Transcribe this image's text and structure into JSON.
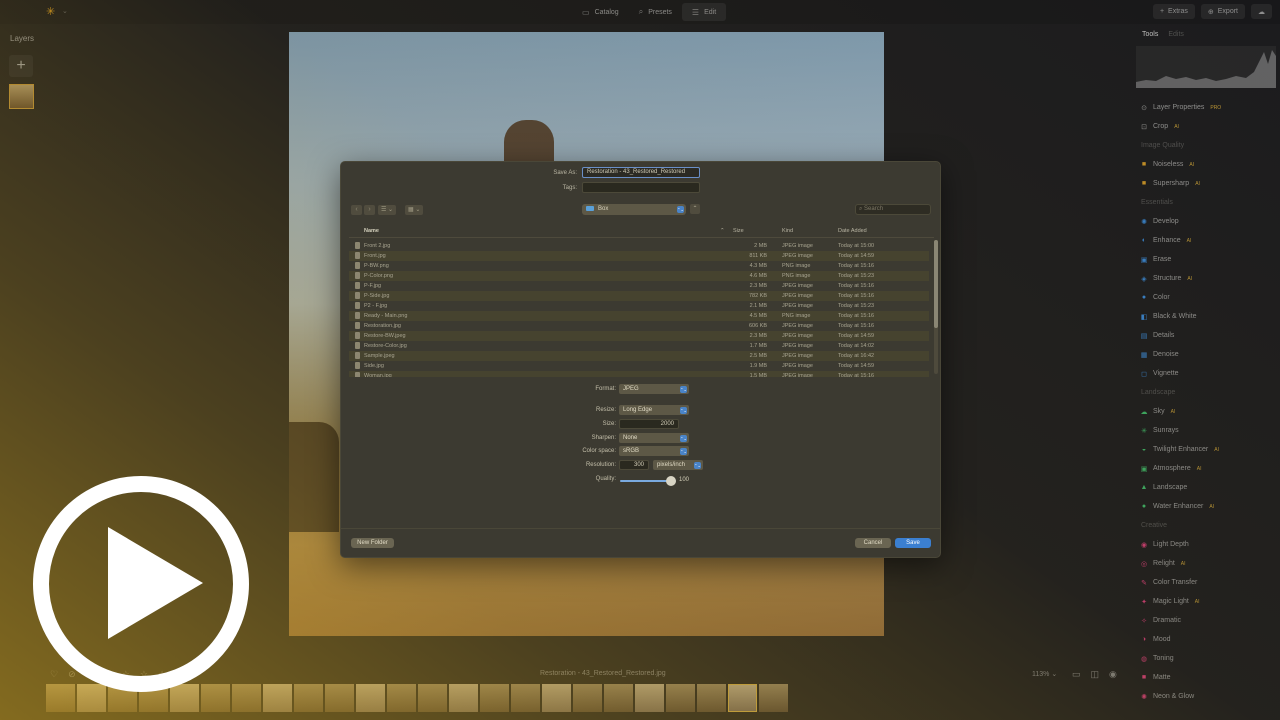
{
  "topbar": {
    "logo_icon": "✳",
    "modes": [
      {
        "icon": "▭",
        "label": "Catalog"
      },
      {
        "icon": "⌕",
        "label": "Presets"
      },
      {
        "icon": "☰",
        "label": "Edit"
      }
    ],
    "extras_label": "Extras",
    "export_label": "Export"
  },
  "layers": {
    "title": "Layers",
    "add_icon": "+"
  },
  "right_panel": {
    "tabs": [
      "Tools",
      "Edits"
    ],
    "items": [
      {
        "type": "item",
        "icon": "⊙",
        "color": "#9a9a9a",
        "label": "Layer Properties",
        "tag": "PRO"
      },
      {
        "type": "item",
        "icon": "⊡",
        "color": "#9a9a9a",
        "label": "Crop",
        "tag": "AI"
      },
      {
        "type": "section",
        "label": "Image Quality"
      },
      {
        "type": "item",
        "icon": "■",
        "color": "#d19a2a",
        "label": "Noiseless",
        "tag": "AI"
      },
      {
        "type": "item",
        "icon": "■",
        "color": "#d19a2a",
        "label": "Supersharp",
        "tag": "AI"
      },
      {
        "type": "section",
        "label": "Essentials"
      },
      {
        "type": "item",
        "icon": "✺",
        "color": "#3b8ad8",
        "label": "Develop",
        "tag": ""
      },
      {
        "type": "item",
        "icon": "◐",
        "color": "#3b8ad8",
        "label": "Enhance",
        "tag": "AI"
      },
      {
        "type": "item",
        "icon": "▣",
        "color": "#3b8ad8",
        "label": "Erase",
        "tag": ""
      },
      {
        "type": "item",
        "icon": "◈",
        "color": "#3b8ad8",
        "label": "Structure",
        "tag": "AI"
      },
      {
        "type": "item",
        "icon": "●",
        "color": "#3b8ad8",
        "label": "Color",
        "tag": ""
      },
      {
        "type": "item",
        "icon": "◧",
        "color": "#3b8ad8",
        "label": "Black & White",
        "tag": ""
      },
      {
        "type": "item",
        "icon": "▤",
        "color": "#3b8ad8",
        "label": "Details",
        "tag": ""
      },
      {
        "type": "item",
        "icon": "▦",
        "color": "#3b8ad8",
        "label": "Denoise",
        "tag": ""
      },
      {
        "type": "item",
        "icon": "◻",
        "color": "#3b8ad8",
        "label": "Vignette",
        "tag": ""
      },
      {
        "type": "section",
        "label": "Landscape"
      },
      {
        "type": "item",
        "icon": "☁",
        "color": "#3fb86a",
        "label": "Sky",
        "tag": "AI"
      },
      {
        "type": "item",
        "icon": "✳",
        "color": "#3fb86a",
        "label": "Sunrays",
        "tag": ""
      },
      {
        "type": "item",
        "icon": "◒",
        "color": "#3fb86a",
        "label": "Twilight Enhancer",
        "tag": "AI"
      },
      {
        "type": "item",
        "icon": "▣",
        "color": "#3fb86a",
        "label": "Atmosphere",
        "tag": "AI"
      },
      {
        "type": "item",
        "icon": "▲",
        "color": "#3fb86a",
        "label": "Landscape",
        "tag": ""
      },
      {
        "type": "item",
        "icon": "●",
        "color": "#3fb86a",
        "label": "Water Enhancer",
        "tag": "AI"
      },
      {
        "type": "section",
        "label": "Creative"
      },
      {
        "type": "item",
        "icon": "◉",
        "color": "#d8407a",
        "label": "Light Depth",
        "tag": ""
      },
      {
        "type": "item",
        "icon": "◎",
        "color": "#d8407a",
        "label": "Relight",
        "tag": "AI"
      },
      {
        "type": "item",
        "icon": "✎",
        "color": "#d8407a",
        "label": "Color Transfer",
        "tag": ""
      },
      {
        "type": "item",
        "icon": "✦",
        "color": "#d8407a",
        "label": "Magic Light",
        "tag": "AI"
      },
      {
        "type": "item",
        "icon": "✧",
        "color": "#d8407a",
        "label": "Dramatic",
        "tag": ""
      },
      {
        "type": "item",
        "icon": "◑",
        "color": "#d8407a",
        "label": "Mood",
        "tag": ""
      },
      {
        "type": "item",
        "icon": "◍",
        "color": "#d8407a",
        "label": "Toning",
        "tag": ""
      },
      {
        "type": "item",
        "icon": "■",
        "color": "#d8407a",
        "label": "Matte",
        "tag": ""
      },
      {
        "type": "item",
        "icon": "✺",
        "color": "#d8407a",
        "label": "Neon & Glow",
        "tag": ""
      }
    ]
  },
  "bottom": {
    "icons": [
      "♡",
      "⊘",
      "☆",
      "☆",
      "☆",
      "☆",
      "☆"
    ],
    "filename": "Restoration - 43_Restored_Restored.jpg",
    "zoom": "113% ⌄",
    "view_icons": [
      "▭",
      "◫",
      "◉"
    ]
  },
  "filmstrip": {
    "count": 24,
    "current_index": 22
  },
  "dialog": {
    "save_as_label": "Save As:",
    "save_as_value": "Restoration - 43_Restored_Restored",
    "tags_label": "Tags:",
    "tags_value": "",
    "back_icon": "‹",
    "forward_icon": "›",
    "list_view_icon": "☰ ⌄",
    "group_view_icon": "▦ ⌄",
    "location": "Box",
    "location_arrow": "⌃⌄",
    "expand_icon": "⌃",
    "search_placeholder": "Search",
    "columns": {
      "name": "Name",
      "size": "Size",
      "kind": "Kind",
      "date": "Date Added",
      "sort_icon": "⌃"
    },
    "files": [
      {
        "name": "Front 2.jpg",
        "size": "2 MB",
        "kind": "JPEG image",
        "date": "Today at 15:00"
      },
      {
        "name": "Front.jpg",
        "size": "811 KB",
        "kind": "JPEG image",
        "date": "Today at 14:59"
      },
      {
        "name": "P-BW.png",
        "size": "4.3 MB",
        "kind": "PNG image",
        "date": "Today at 15:16"
      },
      {
        "name": "P-Color.png",
        "size": "4.6 MB",
        "kind": "PNG image",
        "date": "Today at 15:23"
      },
      {
        "name": "P-F.jpg",
        "size": "2.3 MB",
        "kind": "JPEG image",
        "date": "Today at 15:16"
      },
      {
        "name": "P-Side.jpg",
        "size": "782 KB",
        "kind": "JPEG image",
        "date": "Today at 15:16"
      },
      {
        "name": "P2 - F.jpg",
        "size": "2.1 MB",
        "kind": "JPEG image",
        "date": "Today at 15:23"
      },
      {
        "name": "Ready - Main.png",
        "size": "4.5 MB",
        "kind": "PNG image",
        "date": "Today at 15:16"
      },
      {
        "name": "Restoration.jpg",
        "size": "606 KB",
        "kind": "JPEG image",
        "date": "Today at 15:16"
      },
      {
        "name": "Restore-BW.jpeg",
        "size": "2.3 MB",
        "kind": "JPEG image",
        "date": "Today at 14:59"
      },
      {
        "name": "Restore-Color.jpg",
        "size": "1.7 MB",
        "kind": "JPEG image",
        "date": "Today at 14:02"
      },
      {
        "name": "Sample.jpeg",
        "size": "2.5 MB",
        "kind": "JPEG image",
        "date": "Today at 16:42"
      },
      {
        "name": "Side.jpg",
        "size": "1.9 MB",
        "kind": "JPEG image",
        "date": "Today at 14:59"
      },
      {
        "name": "Woman.jpg",
        "size": "1.5 MB",
        "kind": "JPEG image",
        "date": "Today at 15:16"
      }
    ],
    "format_label": "Format:",
    "format_value": "JPEG",
    "resize_label": "Resize:",
    "resize_value": "Long Edge",
    "size_label": "Size:",
    "size_value": "2000",
    "sharpen_label": "Sharpen:",
    "sharpen_value": "None",
    "color_space_label": "Color space:",
    "color_space_value": "sRGB",
    "resolution_label": "Resolution:",
    "resolution_value": "300",
    "resolution_unit": "pixels/inch",
    "quality_label": "Quality:",
    "quality_value": "100",
    "select_arrow": "⌃⌄",
    "new_folder_label": "New Folder",
    "cancel_label": "Cancel",
    "save_label": "Save"
  },
  "play_overlay": {
    "icon": "play-icon"
  }
}
